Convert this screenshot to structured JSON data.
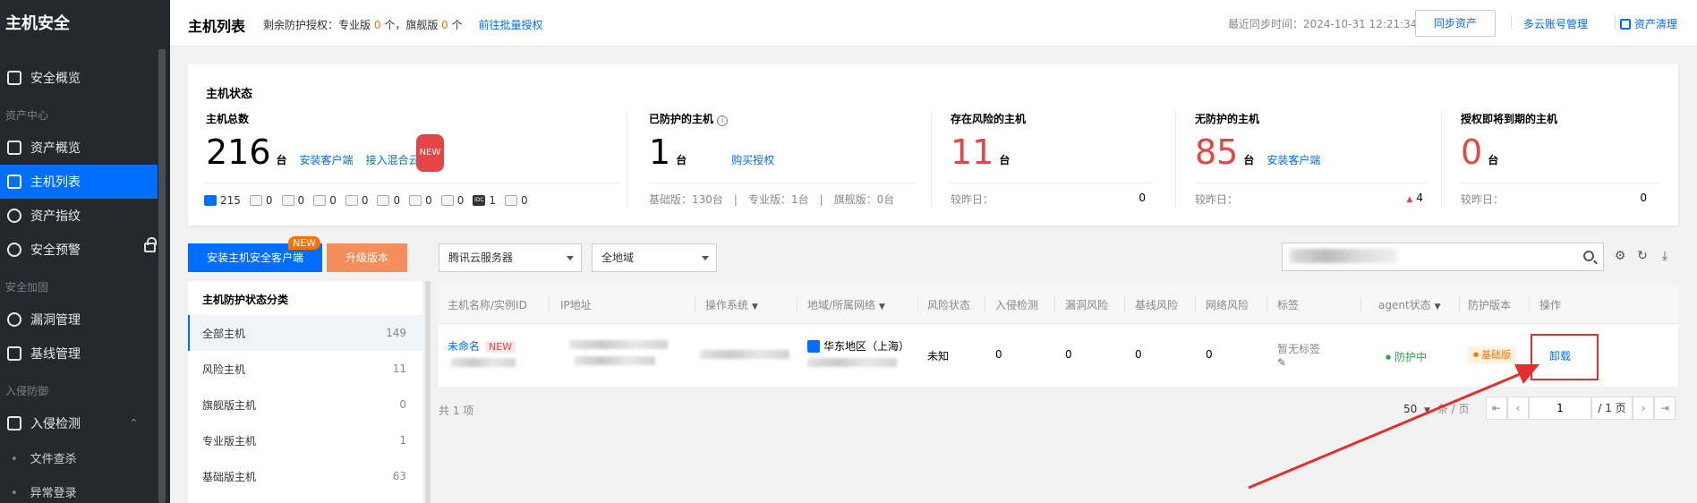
{
  "sidebar": {
    "brand": "主机安全",
    "items": [
      {
        "label": "安全概览"
      },
      {
        "group": "资产中心"
      },
      {
        "label": "资产概览"
      },
      {
        "label": "主机列表"
      },
      {
        "label": "资产指纹"
      },
      {
        "label": "安全预警"
      },
      {
        "group": "安全加固"
      },
      {
        "label": "漏洞管理"
      },
      {
        "label": "基线管理"
      },
      {
        "group": "入侵防御"
      },
      {
        "label": "入侵检测"
      },
      {
        "label": "文件查杀"
      },
      {
        "label": "异常登录"
      }
    ]
  },
  "header": {
    "title": "主机列表",
    "remaining_prefix": "剩余防护授权：专业版",
    "pro_count": "0",
    "mid": "个，旗舰版",
    "flagship_count": "0",
    "suffix": "个",
    "batch_link": "前往批量授权",
    "sync_time": "最近同步时间：2024-10-31 12:21:34",
    "sync_button": "同步资产",
    "multi_cloud": "多云账号管理",
    "asset_clean": "资产清理"
  },
  "status": {
    "title": "主机状态",
    "total": {
      "label": "主机总数",
      "value": "216",
      "unit": "台",
      "link1": "安装客户端",
      "link2": "接入混合云",
      "new": "NEW"
    },
    "platforms": [
      "215",
      "0",
      "0",
      "0",
      "0",
      "0",
      "0",
      "0",
      "1",
      "0"
    ],
    "protected": {
      "label": "已防护的主机",
      "value": "1",
      "unit": "台",
      "link": "购买授权",
      "foot": "基础版：130台　|　专业版：1台　|　旗舰版：0台"
    },
    "risk": {
      "label": "存在风险的主机",
      "value": "11",
      "unit": "台",
      "foot_label": "较昨日：",
      "foot_value": "0"
    },
    "unprotected": {
      "label": "无防护的主机",
      "value": "85",
      "unit": "台",
      "link": "安装客户端",
      "foot_label": "较昨日：",
      "foot_value": "4"
    },
    "expiring": {
      "label": "授权即将到期的主机",
      "value": "0",
      "unit": "台",
      "foot_label": "较昨日：",
      "foot_value": "0"
    }
  },
  "toolbar": {
    "install_btn": "安装主机安全客户端",
    "install_new": "NEW",
    "upgrade_btn": "升级版本",
    "select_cloud": "腾讯云服务器",
    "select_region": "全地域"
  },
  "category": {
    "title": "主机防护状态分类",
    "rows": [
      {
        "label": "全部主机",
        "count": "149"
      },
      {
        "label": "风险主机",
        "count": "11"
      },
      {
        "label": "旗舰版主机",
        "count": "0"
      },
      {
        "label": "专业版主机",
        "count": "1"
      },
      {
        "label": "基础版主机",
        "count": "63"
      }
    ]
  },
  "table": {
    "headers": [
      "主机名称/实例ID",
      "IP地址",
      "操作系统",
      "地域/所属网络",
      "风险状态",
      "入侵检测",
      "漏洞风险",
      "基线风险",
      "网络风险",
      "标签",
      "agent状态",
      "防护版本",
      "操作"
    ],
    "row": {
      "name": "未命名",
      "name_tag": "NEW",
      "region": "华东地区（上海）",
      "risk_status": "未知",
      "intrusion": "0",
      "vuln": "0",
      "baseline": "0",
      "network": "0",
      "tag": "暂无标签",
      "agent": "防护中",
      "version": "基础版",
      "action": "卸载"
    }
  },
  "footer": {
    "total": "共 1 项",
    "page_size": "50",
    "per_page": "条 / 页",
    "page": "1",
    "page_total": "/ 1 页"
  }
}
